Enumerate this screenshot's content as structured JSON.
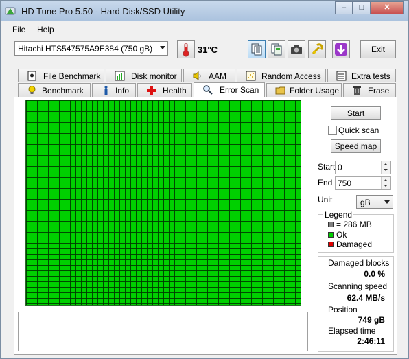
{
  "window": {
    "title": "HD Tune Pro 5.50 - Hard Disk/SSD Utility"
  },
  "menu": {
    "file": "File",
    "help": "Help"
  },
  "toolbar": {
    "drive": "Hitachi HTS547575A9E384 (750 gB)",
    "temperature": "31°C",
    "exit": "Exit"
  },
  "tabs_top": [
    {
      "label": "File Benchmark",
      "icon": "file-benchmark-icon"
    },
    {
      "label": "Disk monitor",
      "icon": "chart-icon"
    },
    {
      "label": "AAM",
      "icon": "speaker-icon"
    },
    {
      "label": "Random Access",
      "icon": "scatter-icon"
    },
    {
      "label": "Extra tests",
      "icon": "list-icon"
    }
  ],
  "tabs_bottom": [
    {
      "label": "Benchmark",
      "icon": "bulb-icon"
    },
    {
      "label": "Info",
      "icon": "info-icon"
    },
    {
      "label": "Health",
      "icon": "health-cross-icon"
    },
    {
      "label": "Error Scan",
      "icon": "magnifier-icon",
      "active": true
    },
    {
      "label": "Folder Usage",
      "icon": "folder-icon"
    },
    {
      "label": "Erase",
      "icon": "trash-icon"
    }
  ],
  "scan": {
    "start_button": "Start",
    "quick_scan": "Quick scan",
    "speed_map": "Speed map",
    "start_label": "Start",
    "start_value": "0",
    "end_label": "End",
    "end_value": "750",
    "unit_label": "Unit",
    "unit_value": "gB"
  },
  "legend": {
    "title": "Legend",
    "block": "= 286 MB",
    "ok": "Ok",
    "damaged": "Damaged",
    "colors": {
      "block": "#808080",
      "ok": "#00d000",
      "damaged": "#e00000"
    }
  },
  "stats": {
    "damaged_blocks_label": "Damaged blocks",
    "damaged_blocks_value": "0.0 %",
    "scanning_speed_label": "Scanning speed",
    "scanning_speed_value": "62.4 MB/s",
    "position_label": "Position",
    "position_value": "749 gB",
    "elapsed_label": "Elapsed time",
    "elapsed_value": "2:46:11"
  }
}
